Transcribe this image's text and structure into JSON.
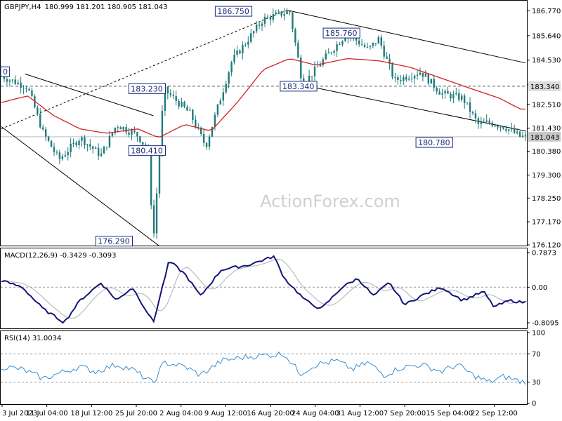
{
  "chart_data": {
    "type": "candlestick",
    "symbol": "GBPJPY,H4",
    "ohlc_header": "180.999 181.201 180.905 181.043",
    "watermark": "ActionForex.com",
    "x_ticks": [
      "3 Jul 2023",
      "11 Jul 04:00",
      "18 Jul 12:00",
      "25 Jul 20:00",
      "2 Aug 04:00",
      "9 Aug 12:00",
      "16 Aug 20:00",
      "24 Aug 04:00",
      "31 Aug 12:00",
      "7 Sep 20:00",
      "15 Sep 04:00",
      "22 Sep 12:00"
    ],
    "price": {
      "ylim": [
        176.12,
        187.2
      ],
      "y_ticks": [
        "186.770",
        "185.640",
        "184.530",
        "183.400",
        "182.510",
        "181.430",
        "180.380",
        "179.300",
        "178.250",
        "177.170",
        "176.120"
      ],
      "y_tick_values": [
        186.77,
        185.64,
        184.53,
        183.4,
        182.51,
        181.43,
        180.38,
        179.3,
        178.25,
        177.17,
        176.12
      ],
      "current_price": "181.043",
      "current_value": 181.043,
      "level_label": "183.340",
      "level_value": 183.34,
      "annotations": [
        {
          "text": "186.750",
          "x": 0.443,
          "y": 186.75
        },
        {
          "text": "185.760",
          "x": 0.649,
          "y": 185.76
        },
        {
          "text": "183.340",
          "x": 0.567,
          "y": 183.34
        },
        {
          "text": "183.230",
          "x": 0.278,
          "y": 183.23
        },
        {
          "text": "180.410",
          "x": 0.278,
          "y": 180.41
        },
        {
          "text": "180.780",
          "x": 0.826,
          "y": 180.78
        },
        {
          "text": "176.290",
          "x": 0.215,
          "y": 176.29
        },
        {
          "text": "0",
          "x": 0.0,
          "y": 184.0
        }
      ],
      "waypoints": [
        [
          0.0,
          183.8
        ],
        [
          0.05,
          183.3
        ],
        [
          0.08,
          181.2
        ],
        [
          0.11,
          180.0
        ],
        [
          0.15,
          181.0
        ],
        [
          0.19,
          180.2
        ],
        [
          0.22,
          181.6
        ],
        [
          0.26,
          181.1
        ],
        [
          0.28,
          180.4
        ],
        [
          0.29,
          176.3
        ],
        [
          0.31,
          183.2
        ],
        [
          0.36,
          182.1
        ],
        [
          0.39,
          180.6
        ],
        [
          0.44,
          184.5
        ],
        [
          0.5,
          186.4
        ],
        [
          0.55,
          186.75
        ],
        [
          0.575,
          183.4
        ],
        [
          0.62,
          184.7
        ],
        [
          0.66,
          185.76
        ],
        [
          0.7,
          185.0
        ],
        [
          0.72,
          185.5
        ],
        [
          0.75,
          183.6
        ],
        [
          0.8,
          184.0
        ],
        [
          0.84,
          183.0
        ],
        [
          0.88,
          182.8
        ],
        [
          0.91,
          181.6
        ],
        [
          0.93,
          181.7
        ],
        [
          0.96,
          181.5
        ],
        [
          0.99,
          181.04
        ]
      ],
      "ma_waypoints": [
        [
          0.0,
          182.6
        ],
        [
          0.05,
          182.9
        ],
        [
          0.1,
          182.0
        ],
        [
          0.15,
          181.4
        ],
        [
          0.2,
          181.2
        ],
        [
          0.26,
          181.4
        ],
        [
          0.3,
          181.0
        ],
        [
          0.35,
          181.6
        ],
        [
          0.4,
          181.3
        ],
        [
          0.45,
          182.6
        ],
        [
          0.5,
          184.1
        ],
        [
          0.55,
          184.6
        ],
        [
          0.6,
          184.3
        ],
        [
          0.66,
          184.6
        ],
        [
          0.72,
          184.5
        ],
        [
          0.78,
          184.2
        ],
        [
          0.84,
          183.7
        ],
        [
          0.9,
          183.2
        ],
        [
          0.95,
          182.8
        ],
        [
          0.99,
          182.3
        ]
      ],
      "trendlines": [
        {
          "from": [
            0.0,
            181.4
          ],
          "to": [
            0.545,
            186.8
          ],
          "style": "dashed"
        },
        {
          "from": [
            0.545,
            186.8
          ],
          "to": [
            1.0,
            184.4
          ],
          "style": "solid"
        },
        {
          "from": [
            0.573,
            183.4
          ],
          "to": [
            1.0,
            181.3
          ],
          "style": "solid"
        },
        {
          "from": [
            0.045,
            183.9
          ],
          "to": [
            0.29,
            182.0
          ],
          "style": "solid"
        },
        {
          "from": [
            0.0,
            181.5
          ],
          "to": [
            0.305,
            176.0
          ],
          "style": "solid"
        }
      ]
    },
    "macd": {
      "label": "MACD(12,26,9) -0.3429 -0.3093",
      "ylim": [
        -0.92,
        0.85
      ],
      "y_ticks": [
        "0.7873",
        "0.00",
        "-0.8095"
      ],
      "y_tick_values": [
        0.7873,
        0.0,
        -0.8095
      ],
      "zero_label": "0.00",
      "waypoints": [
        [
          0.0,
          0.15
        ],
        [
          0.04,
          0.0
        ],
        [
          0.08,
          -0.5
        ],
        [
          0.12,
          -0.8
        ],
        [
          0.15,
          -0.3
        ],
        [
          0.19,
          0.1
        ],
        [
          0.22,
          -0.3
        ],
        [
          0.25,
          0.0
        ],
        [
          0.29,
          -0.8
        ],
        [
          0.32,
          0.6
        ],
        [
          0.35,
          0.3
        ],
        [
          0.38,
          -0.2
        ],
        [
          0.42,
          0.4
        ],
        [
          0.47,
          0.5
        ],
        [
          0.52,
          0.7
        ],
        [
          0.54,
          0.2
        ],
        [
          0.58,
          -0.3
        ],
        [
          0.61,
          -0.5
        ],
        [
          0.65,
          0.0
        ],
        [
          0.68,
          0.2
        ],
        [
          0.71,
          -0.2
        ],
        [
          0.74,
          0.1
        ],
        [
          0.77,
          -0.4
        ],
        [
          0.8,
          -0.2
        ],
        [
          0.84,
          0.0
        ],
        [
          0.88,
          -0.3
        ],
        [
          0.92,
          -0.1
        ],
        [
          0.94,
          -0.45
        ],
        [
          0.97,
          -0.3
        ],
        [
          0.99,
          -0.34
        ]
      ]
    },
    "rsi": {
      "label": "RSI(14) 31.0034",
      "ylim": [
        0,
        100
      ],
      "y_ticks": [
        "100",
        "70",
        "30",
        "0"
      ],
      "y_tick_values": [
        100,
        70,
        30,
        0
      ],
      "levels": [
        70,
        30
      ],
      "waypoints": [
        [
          0.0,
          52
        ],
        [
          0.04,
          48
        ],
        [
          0.08,
          35
        ],
        [
          0.12,
          45
        ],
        [
          0.15,
          52
        ],
        [
          0.18,
          45
        ],
        [
          0.22,
          55
        ],
        [
          0.25,
          48
        ],
        [
          0.29,
          28
        ],
        [
          0.31,
          58
        ],
        [
          0.35,
          52
        ],
        [
          0.38,
          40
        ],
        [
          0.42,
          60
        ],
        [
          0.46,
          65
        ],
        [
          0.5,
          68
        ],
        [
          0.54,
          70
        ],
        [
          0.57,
          42
        ],
        [
          0.6,
          55
        ],
        [
          0.64,
          60
        ],
        [
          0.67,
          48
        ],
        [
          0.7,
          58
        ],
        [
          0.73,
          40
        ],
        [
          0.76,
          50
        ],
        [
          0.8,
          55
        ],
        [
          0.84,
          45
        ],
        [
          0.87,
          55
        ],
        [
          0.9,
          40
        ],
        [
          0.93,
          30
        ],
        [
          0.96,
          38
        ],
        [
          0.99,
          31
        ]
      ]
    },
    "colors": {
      "candle": "#1f7a7a",
      "ma": "#d42020",
      "macd": "#14147a",
      "signal": "#b0b0b0",
      "rsi": "#3a8fd0",
      "label_box": "#1c2a78"
    }
  }
}
